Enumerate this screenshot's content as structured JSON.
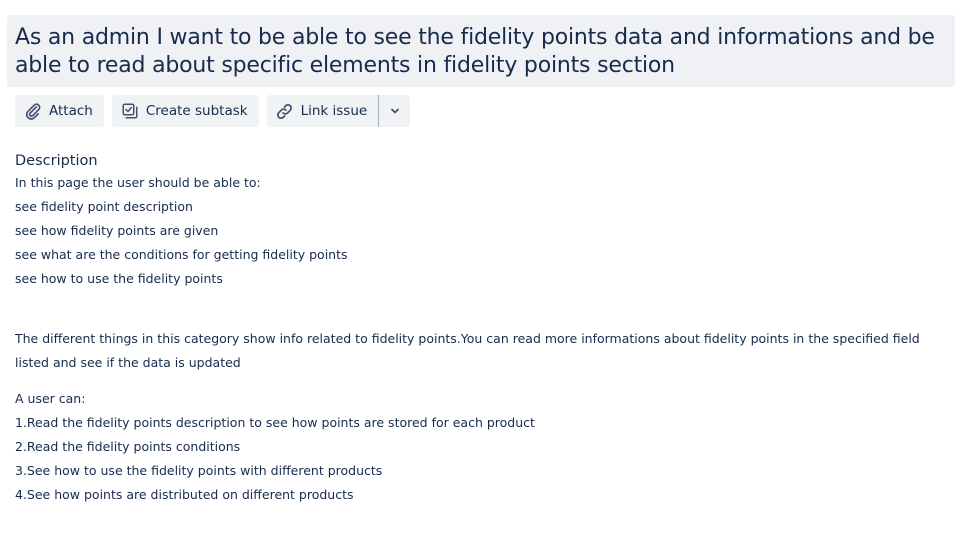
{
  "issue": {
    "title": "As an admin I want to be able to see the fidelity points data and informations and be able to read about specific elements in fidelity points section"
  },
  "toolbar": {
    "attach_label": "Attach",
    "create_subtask_label": "Create subtask",
    "link_issue_label": "Link issue"
  },
  "description": {
    "heading": "Description",
    "intro": "In this page the user should be able to:",
    "abilities": [
      "see fidelity point description",
      "see how fidelity points are given",
      "see what are the conditions for getting fidelity points",
      "see how to use the fidelity points"
    ],
    "paragraph": "The different things in this category show info related to fidelity points.You can read more informations about fidelity points in the specified field listed and see if the data is updated",
    "user_can_heading": "A user can:",
    "user_can_items": [
      "1.Read the fidelity points description to see how points are stored for each product",
      "2.Read the fidelity points conditions",
      "3.See how to use the fidelity points with different products",
      "4.See how points are distributed on different products"
    ]
  },
  "colors": {
    "text": "#172b4d",
    "title_background": "#f0f1f4",
    "button_background": "#f1f2f4"
  },
  "icons": {
    "attach": "paperclip-icon",
    "create_subtask": "subtask-icon",
    "link_issue": "link-icon",
    "more": "chevron-down-icon"
  }
}
